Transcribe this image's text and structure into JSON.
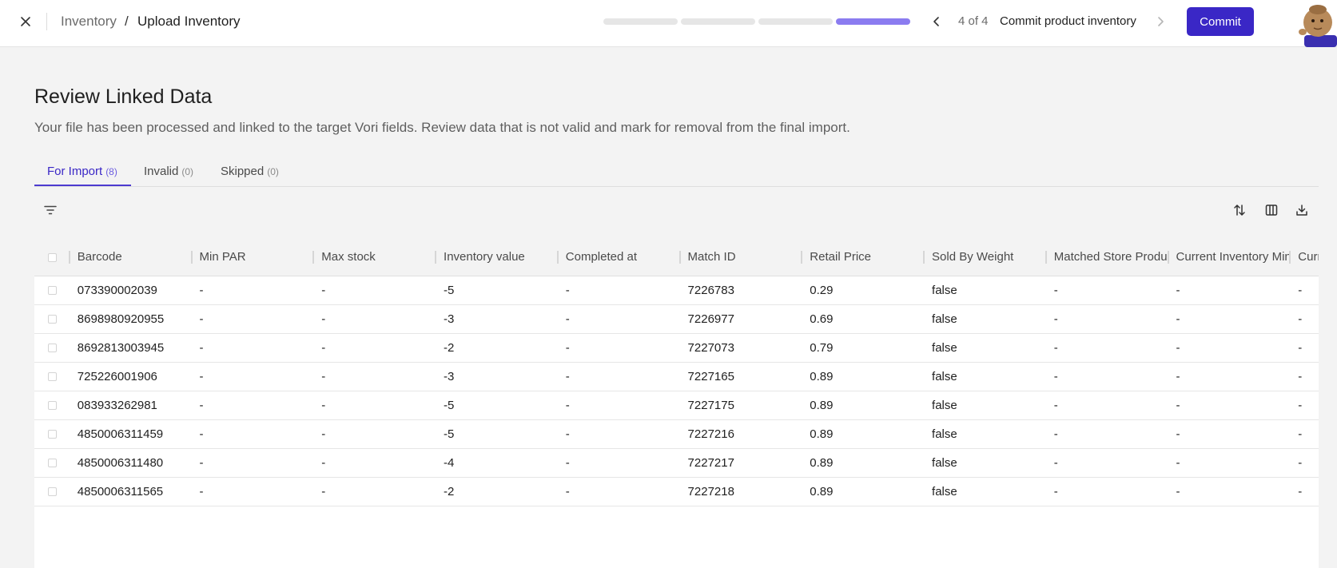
{
  "header": {
    "breadcrumb_root": "Inventory",
    "breadcrumb_sep": "/",
    "breadcrumb_current": "Upload Inventory",
    "step_count": "4 of 4",
    "step_name": "Commit product inventory",
    "commit_label": "Commit",
    "progress_steps": 4,
    "progress_active_step": 4
  },
  "page": {
    "title": "Review Linked Data",
    "description": "Your file has been processed and linked to the target Vori fields. Review data that is not valid and mark for removal from the final import."
  },
  "tabs": [
    {
      "label": "For Import",
      "count": "(8)"
    },
    {
      "label": "Invalid",
      "count": "(0)"
    },
    {
      "label": "Skipped",
      "count": "(0)"
    }
  ],
  "table": {
    "columns": [
      "Barcode",
      "Min PAR",
      "Max stock",
      "Inventory value",
      "Completed at",
      "Match ID",
      "Retail Price",
      "Sold By Weight",
      "Matched Store Product",
      "Current Inventory Min",
      "Current"
    ],
    "rows": [
      [
        "073390002039",
        "-",
        "-",
        "-5",
        "-",
        "7226783",
        "0.29",
        "false",
        "-",
        "-",
        "-"
      ],
      [
        "8698980920955",
        "-",
        "-",
        "-3",
        "-",
        "7226977",
        "0.69",
        "false",
        "-",
        "-",
        "-"
      ],
      [
        "8692813003945",
        "-",
        "-",
        "-2",
        "-",
        "7227073",
        "0.79",
        "false",
        "-",
        "-",
        "-"
      ],
      [
        "725226001906",
        "-",
        "-",
        "-3",
        "-",
        "7227165",
        "0.89",
        "false",
        "-",
        "-",
        "-"
      ],
      [
        "083933262981",
        "-",
        "-",
        "-5",
        "-",
        "7227175",
        "0.89",
        "false",
        "-",
        "-",
        "-"
      ],
      [
        "4850006311459",
        "-",
        "-",
        "-5",
        "-",
        "7227216",
        "0.89",
        "false",
        "-",
        "-",
        "-"
      ],
      [
        "4850006311480",
        "-",
        "-",
        "-4",
        "-",
        "7227217",
        "0.89",
        "false",
        "-",
        "-",
        "-"
      ],
      [
        "4850006311565",
        "-",
        "-",
        "-2",
        "-",
        "7227218",
        "0.89",
        "false",
        "-",
        "-",
        "-"
      ]
    ]
  },
  "icons": {
    "close": "close-icon",
    "prev": "chevron-left-icon",
    "next": "chevron-right-icon",
    "filter": "filter-icon",
    "sort": "sort-icon",
    "columns": "columns-icon",
    "download": "download-icon"
  },
  "colors": {
    "accent": "#3a27c6",
    "progress_active": "#8b7cf0",
    "progress_inactive": "#e6e6e6"
  }
}
